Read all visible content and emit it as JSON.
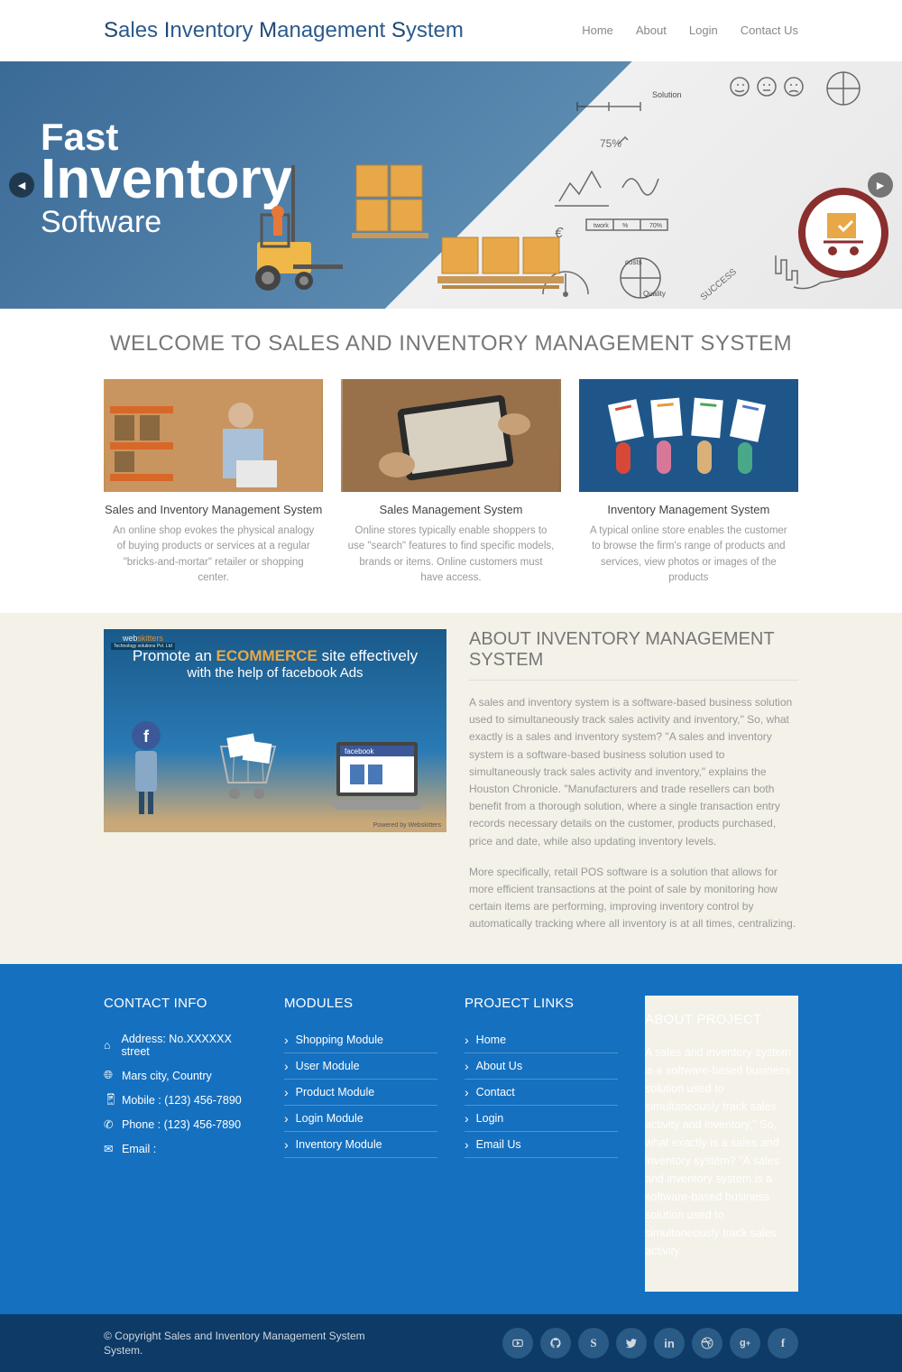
{
  "header": {
    "logo_parts": [
      "S",
      "ales ",
      "I",
      "nventory ",
      "M",
      "anagement ",
      "S",
      "ystem"
    ],
    "nav": [
      "Home",
      "About",
      "Login",
      "Contact Us"
    ]
  },
  "hero": {
    "line1": "Fast",
    "line2": "Inventory",
    "line3": "Software"
  },
  "welcome": {
    "heading": "WELCOME TO SALES AND INVENTORY MANAGEMENT SYSTEM",
    "cards": [
      {
        "title": "Sales and Inventory Management System",
        "desc": "An online shop evokes the physical analogy of buying products or services at a regular \"bricks-and-mortar\" retailer or shopping center."
      },
      {
        "title": "Sales Management System",
        "desc": "Online stores typically enable shoppers to use \"search\" features to find specific models, brands or items. Online customers must have access."
      },
      {
        "title": "Inventory Management System",
        "desc": "A typical online store enables the customer to browse the firm's range of products and services, view photos or images of the products"
      }
    ]
  },
  "about": {
    "heading": "ABOUT INVENTORY MANAGEMENT SYSTEM",
    "promo_l1a": "Promote an ",
    "promo_l1b": "ECOMMERCE",
    "promo_l1c": " site effectively",
    "promo_l2": "with the help of  facebook  Ads",
    "promo_credit": "Powered by Webskitters",
    "p1": "A sales and inventory system is a software-based business solution used to simultaneously track sales activity and inventory,\" So, what exactly is a sales and inventory system? \"A sales and inventory system is a software-based business solution used to simultaneously track sales activity and inventory,\" explains the Houston Chronicle. \"Manufacturers and trade resellers can both benefit from a thorough solution, where a single transaction entry records necessary details on the customer, products purchased, price and date, while also updating inventory levels.",
    "p2": "More specifically, retail POS software is a solution that allows for more efficient transactions at the point of sale by monitoring how certain items are performing, improving inventory control by automatically tracking where all inventory is at all times, centralizing."
  },
  "footer": {
    "contact_heading": "CONTACT INFO",
    "contact": [
      {
        "icon": "home",
        "label": "Address: No.XXXXXX street"
      },
      {
        "icon": "globe",
        "label": "Mars city, Country"
      },
      {
        "icon": "mobile",
        "label": "Mobile : (123) 456-7890"
      },
      {
        "icon": "phone",
        "label": "Phone : (123) 456-7890"
      },
      {
        "icon": "mail",
        "label": "Email :"
      }
    ],
    "modules_heading": "MODULES",
    "modules": [
      "Shopping Module",
      "User Module",
      "Product Module",
      "Login Module",
      "Inventory Module"
    ],
    "links_heading": "PROJECT LINKS",
    "links": [
      "Home",
      "About Us",
      "Contact",
      "Login",
      "Email Us"
    ],
    "about_heading": "ABOUT PROJECT",
    "about_text": "A sales and inventory system is a software-based business solution used to simultaneously track sales activity and inventory,\" So, what exactly is a sales and inventory system? \"A sales and inventory system is a software-based business solution used to simultaneously track sales activity."
  },
  "bottom": {
    "copyright": "© Copyright Sales and Inventory Management System System.",
    "socials": [
      "youtube",
      "github",
      "skype",
      "twitter",
      "linkedin",
      "dribbble",
      "gplus",
      "facebook"
    ]
  }
}
